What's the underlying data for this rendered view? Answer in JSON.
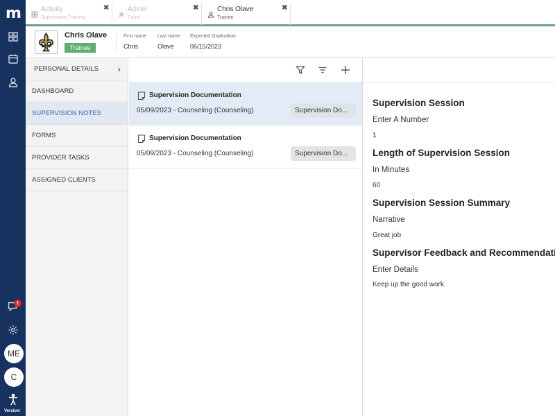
{
  "rail": {
    "logo": "m",
    "icons": [
      "dashboard-grid-icon",
      "calendar-icon",
      "person-icon",
      "chat-icon",
      "gear-icon",
      "accessibility-icon"
    ],
    "notification_count": "1",
    "avatar_me": "ME",
    "avatar_c": "C",
    "version_label": "Version:"
  },
  "tabs": [
    {
      "title": "Activity",
      "subtitle": "Supervision-Training",
      "icon": "grid-icon",
      "active": false
    },
    {
      "title": "Admin",
      "subtitle": "Panel",
      "icon": "gear-icon",
      "active": false
    },
    {
      "title": "Chris Olave",
      "subtitle": "Trainee",
      "icon": "person-icon",
      "active": true
    }
  ],
  "header": {
    "name": "Chris Olave",
    "role": "Trainee",
    "first_name_label": "First name",
    "first_name": "Chris",
    "last_name_label": "Last name",
    "last_name": "Olave",
    "graduation_label": "Expected Graduation",
    "graduation": "06/15/2023"
  },
  "sidebar": {
    "items": [
      {
        "label": "PERSONAL DETAILS",
        "active": false
      },
      {
        "label": "DASHBOARD",
        "active": false
      },
      {
        "label": "SUPERVISION NOTES",
        "active": true
      },
      {
        "label": "FORMS",
        "active": false
      },
      {
        "label": "PROVIDER TASKS",
        "active": false
      },
      {
        "label": "ASSIGNED CLIENTS",
        "active": false
      }
    ]
  },
  "list": {
    "toolbar_icons": [
      "filter-icon",
      "sort-icon",
      "add-icon"
    ],
    "cards": [
      {
        "title": "Supervision Documentation",
        "subtitle": "05/09/2023 - Counseling (Counseling)",
        "badge": "Supervision Do...",
        "selected": true
      },
      {
        "title": "Supervision Documentation",
        "subtitle": "05/09/2023 - Counseling (Counseling)",
        "badge": "Supervision Do...",
        "selected": false
      }
    ]
  },
  "detail": {
    "sections": [
      {
        "heading": "Supervision Session",
        "question": "Enter A Number",
        "answer": "1"
      },
      {
        "heading": "Length of Supervision Session",
        "question": "In Minutes",
        "answer": "60"
      },
      {
        "heading": "Supervision Session Summary",
        "question": "Narrative",
        "answer": "Great job"
      },
      {
        "heading": "Supervisor Feedback and Recommendations",
        "question": "Enter Details",
        "answer": "Keep up the good work."
      }
    ]
  },
  "colors": {
    "rail": "#17325f",
    "tab_accent": "#6aa37c",
    "badge_green": "#5fae6e",
    "active_nav": "#3a6aa8",
    "notification": "#d0282a"
  }
}
